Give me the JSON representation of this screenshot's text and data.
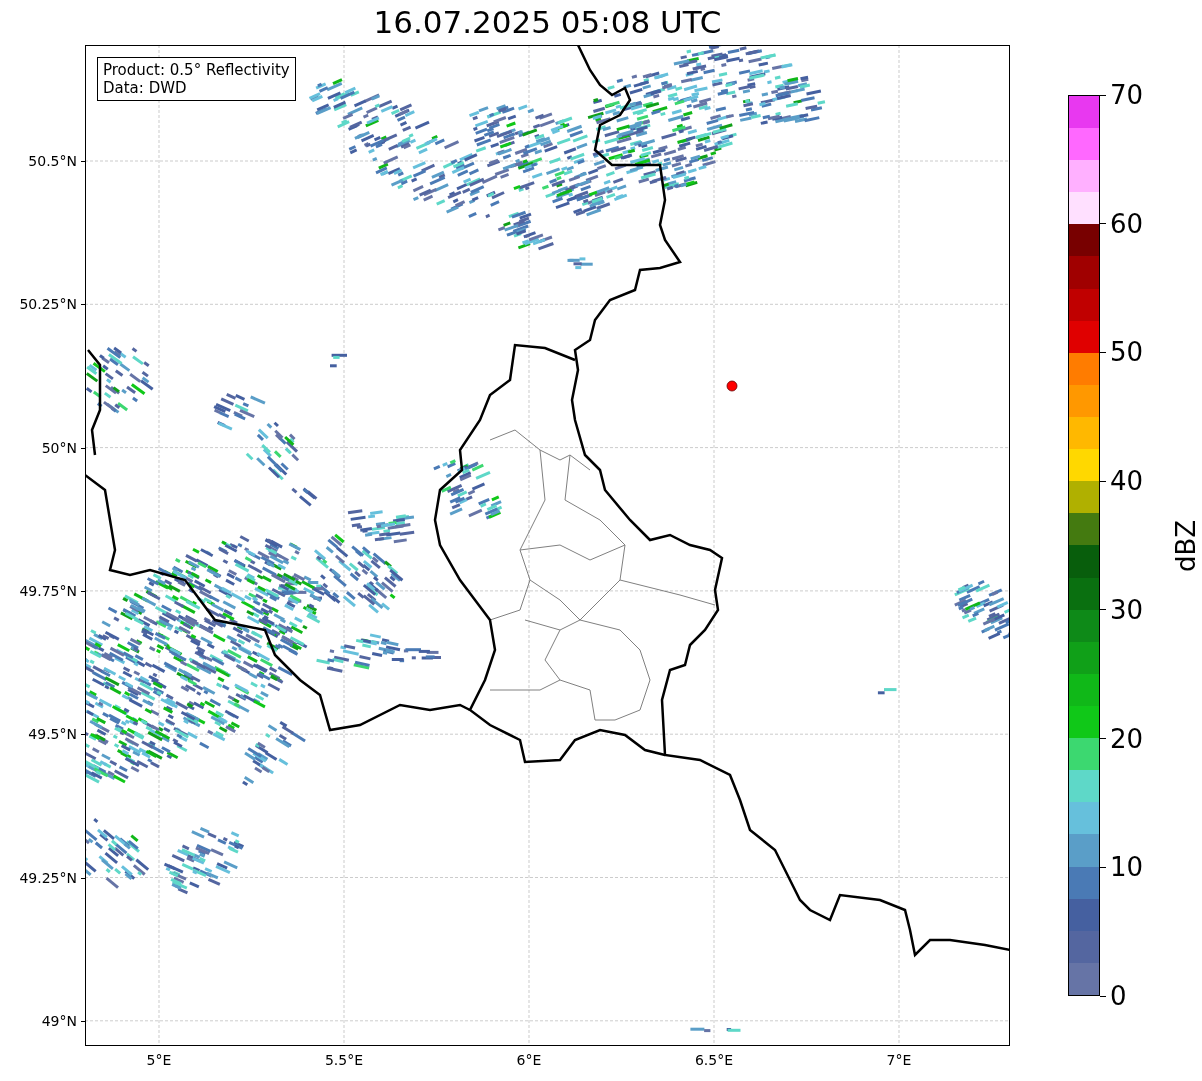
{
  "title": "16.07.2025 05:08 UTC",
  "info_box": {
    "lines": [
      "Product: 0.5° Reflectivity",
      "Data: DWD"
    ]
  },
  "map": {
    "x_ticks": [
      "5°E",
      "5.5°E",
      "6°E",
      "6.5°E",
      "7°E"
    ],
    "y_ticks": [
      "50.5°N",
      "50.25°N",
      "50°N",
      "49.75°N",
      "49.5°N",
      "49.25°N",
      "49°N"
    ]
  },
  "colorbar": {
    "label": "dBZ",
    "ticks": [
      "70",
      "60",
      "50",
      "40",
      "30",
      "20",
      "10",
      "0"
    ],
    "bins": [
      {
        "color": "#6674a6"
      },
      {
        "color": "#5466a0"
      },
      {
        "color": "#4560a0"
      },
      {
        "color": "#4a7ab5"
      },
      {
        "color": "#5a9ec8"
      },
      {
        "color": "#66c0dc"
      },
      {
        "color": "#5ed8c8"
      },
      {
        "color": "#3cd870"
      },
      {
        "color": "#10c818"
      },
      {
        "color": "#10b818"
      },
      {
        "color": "#10a018"
      },
      {
        "color": "#0e8a18"
      },
      {
        "color": "#0a7010"
      },
      {
        "color": "#085e0c"
      },
      {
        "color": "#447a10"
      },
      {
        "color": "#b0b000"
      },
      {
        "color": "#ffd800"
      },
      {
        "color": "#ffb800"
      },
      {
        "color": "#ff9800"
      },
      {
        "color": "#ff7c00"
      },
      {
        "color": "#e00000"
      },
      {
        "color": "#c00000"
      },
      {
        "color": "#a00000"
      },
      {
        "color": "#780000"
      },
      {
        "color": "#ffe0ff"
      },
      {
        "color": "#ffb0ff"
      },
      {
        "color": "#ff68ff"
      },
      {
        "color": "#e838f0"
      }
    ]
  }
}
